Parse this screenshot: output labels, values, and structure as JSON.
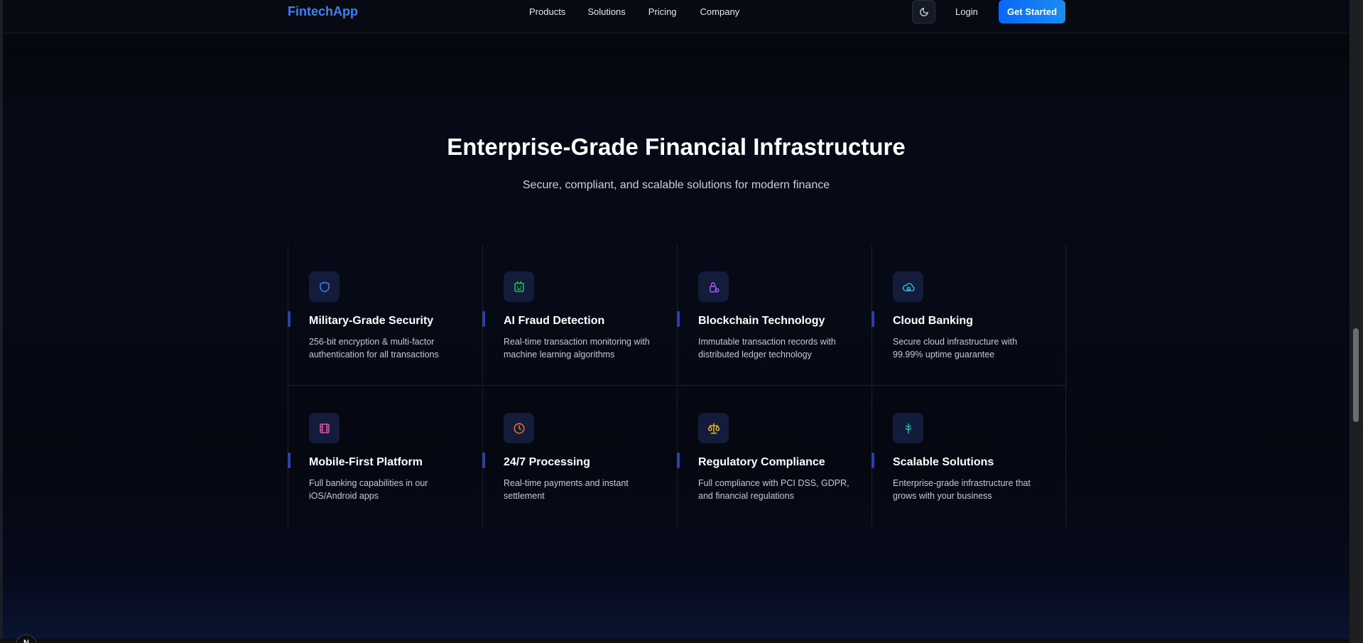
{
  "header": {
    "brand": "FintechApp",
    "nav": [
      "Products",
      "Solutions",
      "Pricing",
      "Company"
    ],
    "theme_toggle_icon": "moon-icon",
    "login": "Login",
    "cta": "Get Started"
  },
  "hero": {
    "title": "Enterprise-Grade Financial Infrastructure",
    "subtitle": "Secure, compliant, and scalable solutions for modern finance"
  },
  "features": [
    {
      "title": "Military-Grade Security",
      "desc": "256-bit encryption & multi-factor authentication for all transactions",
      "icon": "shield-icon",
      "color": "#3b82f6"
    },
    {
      "title": "AI Fraud Detection",
      "desc": "Real-time transaction monitoring with machine learning algorithms",
      "icon": "bot-icon",
      "color": "#22c55e"
    },
    {
      "title": "Blockchain Technology",
      "desc": "Immutable transaction records with distributed ledger technology",
      "icon": "lock-icon",
      "color": "#a855f7"
    },
    {
      "title": "Cloud Banking",
      "desc": "Secure cloud infrastructure with 99.99% uptime guarantee",
      "icon": "cloud-icon",
      "color": "#22b8d8"
    },
    {
      "title": "Mobile-First Platform",
      "desc": "Full banking capabilities in our iOS/Android apps",
      "icon": "film-icon",
      "color": "#ec4899"
    },
    {
      "title": "24/7 Processing",
      "desc": "Real-time payments and instant settlement",
      "icon": "clock-icon",
      "color": "#f97316"
    },
    {
      "title": "Regulatory Compliance",
      "desc": "Full compliance with PCI DSS, GDPR, and financial regulations",
      "icon": "scale-icon",
      "color": "#eab308"
    },
    {
      "title": "Scalable Solutions",
      "desc": "Enterprise-grade infrastructure that grows with your business",
      "icon": "tree-icon",
      "color": "#14b8a6"
    }
  ],
  "corner_badge": "N"
}
